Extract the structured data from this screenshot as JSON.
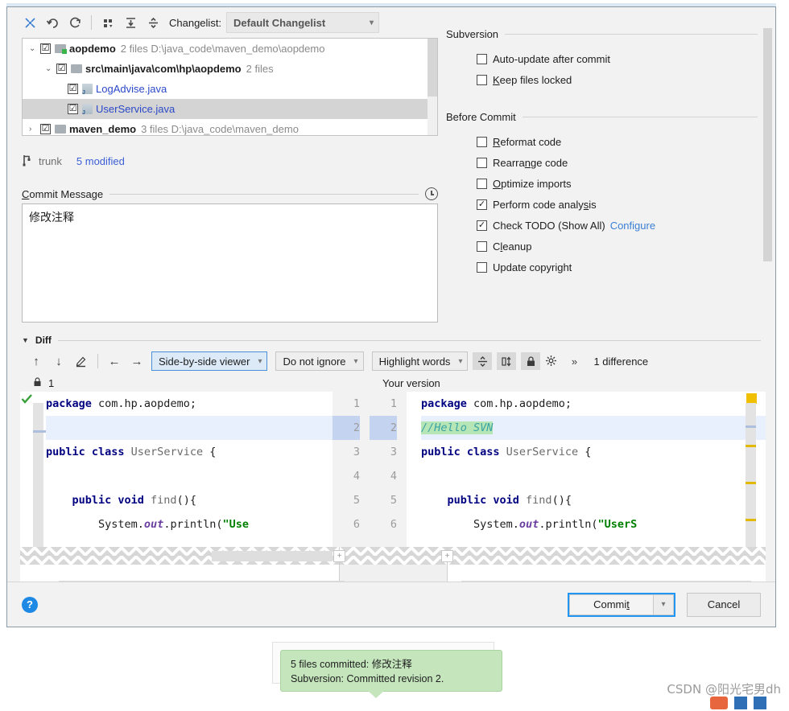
{
  "toolbar": {
    "icons": [
      {
        "name": "expand-collapse-icon",
        "glyph": "⤧"
      },
      {
        "name": "revert-icon",
        "glyph": "↺"
      },
      {
        "name": "refresh-icon",
        "glyph": "⟳"
      },
      {
        "name": "group-by-icon",
        "glyph": "⠿"
      },
      {
        "name": "expand-all-icon",
        "glyph": "⤓"
      },
      {
        "name": "collapse-all-icon",
        "glyph": "⤒"
      }
    ],
    "changelist_label": "Changelist:",
    "changelist_value": "Default Changelist"
  },
  "tree": {
    "rows": [
      {
        "twisty": "⌄",
        "check": "☑",
        "name": "aopdemo",
        "meta": "2 files  D:\\java_code\\maven_demo\\aopdemo",
        "kind": "folder-green",
        "selected": false
      },
      {
        "twisty": "⌄",
        "check": "☑",
        "name": "src\\main\\java\\com\\hp\\aopdemo",
        "meta": "2 files",
        "kind": "folder",
        "selected": false
      },
      {
        "twisty": "",
        "check": "☑",
        "name": "LogAdvise.java",
        "meta": "",
        "kind": "java",
        "selected": false
      },
      {
        "twisty": "",
        "check": "☑",
        "name": "UserService.java",
        "meta": "",
        "kind": "java",
        "selected": true
      },
      {
        "twisty": "›",
        "check": "☑",
        "name": "maven_demo",
        "meta": "3 files  D:\\java_code\\maven_demo",
        "kind": "folder",
        "selected": false
      }
    ]
  },
  "branch": {
    "icon": "branch-icon",
    "name": "trunk",
    "modified": "5 modified"
  },
  "commit_message": {
    "label": "Commit Message",
    "underline_char": "C",
    "value": "修改注释",
    "history_icon": "clock-icon"
  },
  "options": {
    "groups": [
      {
        "title": "Subversion",
        "items": [
          {
            "label": "Auto-update after commit",
            "checked": false,
            "mnemonic": ""
          },
          {
            "label": "Keep files locked",
            "checked": false,
            "mnemonic": "K"
          }
        ]
      },
      {
        "title": "Before Commit",
        "items": [
          {
            "label": "Reformat code",
            "checked": false,
            "mnemonic": "R"
          },
          {
            "label": "Rearrange code",
            "checked": false,
            "mnemonic": "n"
          },
          {
            "label": "Optimize imports",
            "checked": false,
            "mnemonic": "O"
          },
          {
            "label": "Perform code analysis",
            "checked": true,
            "mnemonic": "s"
          },
          {
            "label": "Check TODO (Show All)",
            "checked": true,
            "mnemonic": "",
            "link": "Configure"
          },
          {
            "label": "Cleanup",
            "checked": false,
            "mnemonic": "l"
          },
          {
            "label": "Update copyright",
            "checked": false,
            "mnemonic": ""
          }
        ]
      }
    ]
  },
  "diff": {
    "section_title": "Diff",
    "nav_icons": [
      {
        "name": "previous-difference-icon",
        "glyph": "↑"
      },
      {
        "name": "next-difference-icon",
        "glyph": "↓"
      },
      {
        "name": "edit-source-icon",
        "glyph": "✎"
      },
      {
        "name": "accept-left-icon",
        "glyph": "←"
      },
      {
        "name": "accept-right-icon",
        "glyph": "→"
      }
    ],
    "viewer_mode": "Side-by-side viewer",
    "whitespace_mode": "Do not ignore",
    "highlight_mode": "Highlight words",
    "toggle_icons": [
      {
        "name": "collapse-unchanged-icon",
        "glyph": "⥮"
      },
      {
        "name": "align-panes-icon",
        "glyph": "▯↕"
      },
      {
        "name": "lock-readonly-icon",
        "glyph": "🔒"
      },
      {
        "name": "settings-gear-icon",
        "glyph": "✿"
      },
      {
        "name": "more-actions-icon",
        "glyph": "»"
      }
    ],
    "difference_count": "1 difference",
    "left_title": "1",
    "left_title_icon": "lock-icon",
    "right_title": "Your version",
    "left_lines": [
      {
        "no": "",
        "segments": [
          {
            "t": "package",
            "c": "kw"
          },
          {
            "t": " com.hp.aopdemo;",
            "c": "plain"
          }
        ],
        "state": "normal"
      },
      {
        "no": "",
        "segments": [],
        "state": "inserted-placeholder"
      },
      {
        "no": "",
        "segments": [
          {
            "t": "public class",
            "c": "kw"
          },
          {
            "t": " UserService ",
            "c": "cls"
          },
          {
            "t": "{",
            "c": "plain"
          }
        ],
        "state": "normal"
      },
      {
        "no": "",
        "segments": [],
        "state": "normal"
      },
      {
        "no": "",
        "segments": [
          {
            "t": "    public void",
            "c": "kw"
          },
          {
            "t": " find",
            "c": "cls"
          },
          {
            "t": "(){",
            "c": "plain"
          }
        ],
        "state": "normal"
      },
      {
        "no": "",
        "segments": [
          {
            "t": "        System.",
            "c": "plain"
          },
          {
            "t": "out",
            "c": "fld"
          },
          {
            "t": ".println(",
            "c": "plain"
          },
          {
            "t": "\"Use",
            "c": "str"
          }
        ],
        "state": "normal"
      }
    ],
    "left_numbers": [
      "1",
      "2",
      "3",
      "4",
      "5",
      "6"
    ],
    "right_numbers": [
      "1",
      "2",
      "3",
      "4",
      "5",
      "6"
    ],
    "right_lines": [
      {
        "segments": [
          {
            "t": "package",
            "c": "kw"
          },
          {
            "t": " com.hp.aopdemo;",
            "c": "plain"
          }
        ],
        "state": "normal"
      },
      {
        "segments": [
          {
            "t": "//Hello SVN",
            "c": "cmt-hl"
          }
        ],
        "state": "inserted"
      },
      {
        "segments": [
          {
            "t": "public class",
            "c": "kw"
          },
          {
            "t": " UserService ",
            "c": "cls"
          },
          {
            "t": "{",
            "c": "plain"
          }
        ],
        "state": "normal"
      },
      {
        "segments": [],
        "state": "normal"
      },
      {
        "segments": [
          {
            "t": "    public void",
            "c": "kw"
          },
          {
            "t": " find",
            "c": "cls"
          },
          {
            "t": "(){",
            "c": "plain"
          }
        ],
        "state": "normal"
      },
      {
        "segments": [
          {
            "t": "        System.",
            "c": "plain"
          },
          {
            "t": "out",
            "c": "fld"
          },
          {
            "t": ".println(",
            "c": "plain"
          },
          {
            "t": "\"UserS",
            "c": "str"
          }
        ],
        "state": "normal"
      }
    ],
    "fold_button_label": "+"
  },
  "footer": {
    "help_icon": "help-icon",
    "help_glyph": "?",
    "commit_label": "Commit",
    "commit_mnemonic": "t",
    "commit_dropdown_icon": "chevron-down-icon",
    "cancel_label": "Cancel"
  },
  "notification": {
    "line1": "5 files committed: 修改注释",
    "line2": "Subversion: Committed revision 2."
  },
  "watermark": {
    "text": "CSDN @阳光宅男dh"
  },
  "colors": {
    "accent_blue": "#2196f3",
    "link_blue": "#3b7fd4",
    "inserted_green": "#b6e5b6",
    "notification_green": "#c5e6bd",
    "marker_gold": "#e3b800",
    "changed_row": "#c4d3f0"
  }
}
